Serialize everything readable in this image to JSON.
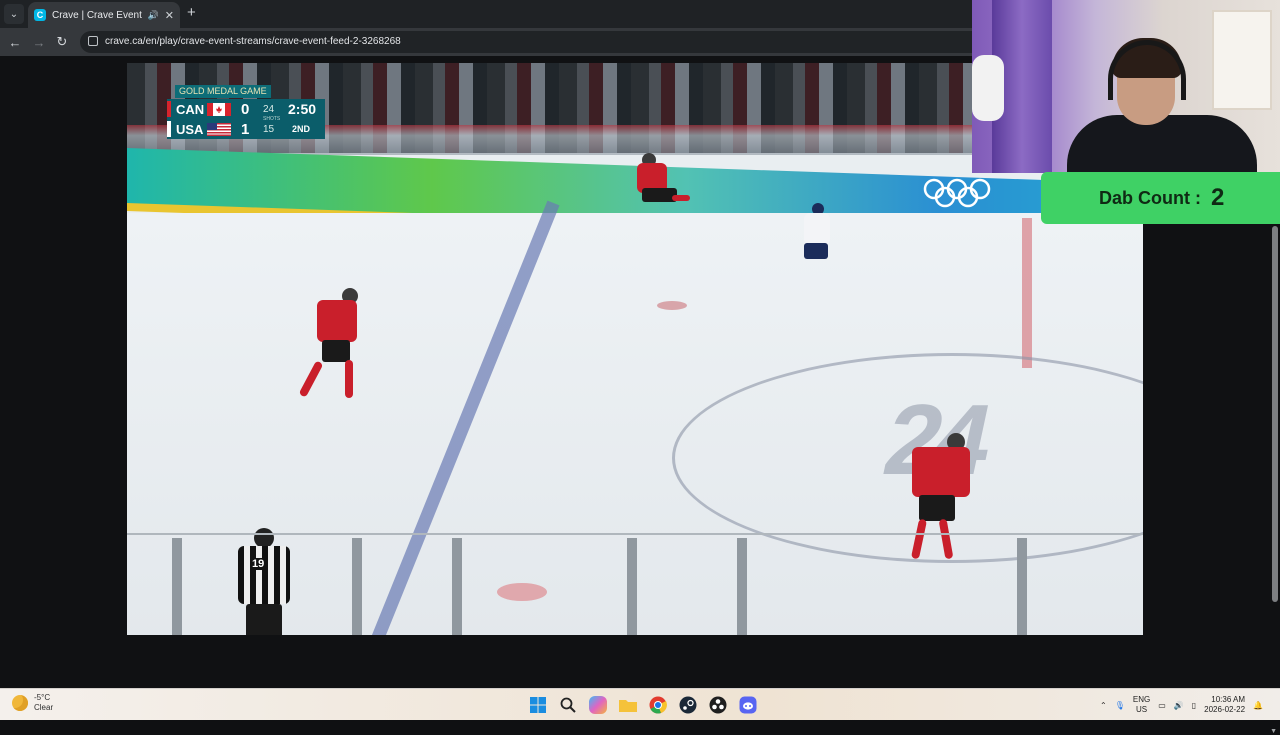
{
  "browser": {
    "tab_title": "Crave | Crave Event Streams",
    "favicon_letter": "C",
    "url": "crave.ca/en/play/crave-event-streams/crave-event-feed-2-3268268"
  },
  "scorebug": {
    "title": "GOLD MEDAL GAME",
    "shots_label": "SHOTS",
    "clock": "2:50",
    "period": "2ND",
    "teams": [
      {
        "abbr": "CAN",
        "score": "0",
        "shots": "24",
        "accent": "#d8242d"
      },
      {
        "abbr": "USA",
        "score": "1",
        "shots": "15",
        "accent": "#ffffff"
      }
    ]
  },
  "video": {
    "jersey_referee": "19"
  },
  "overlay": {
    "dab_label": "Dab Count :",
    "dab_value": "2"
  },
  "taskbar": {
    "temperature": "-5°C",
    "condition": "Clear",
    "language": "ENG",
    "region": "US",
    "time": "10:36 AM",
    "date": "2026-02-22",
    "apps": [
      "start-icon",
      "search-icon",
      "copilot-icon",
      "file-explorer-icon",
      "chrome-icon",
      "steam-icon",
      "obs-icon",
      "discord-icon"
    ]
  }
}
